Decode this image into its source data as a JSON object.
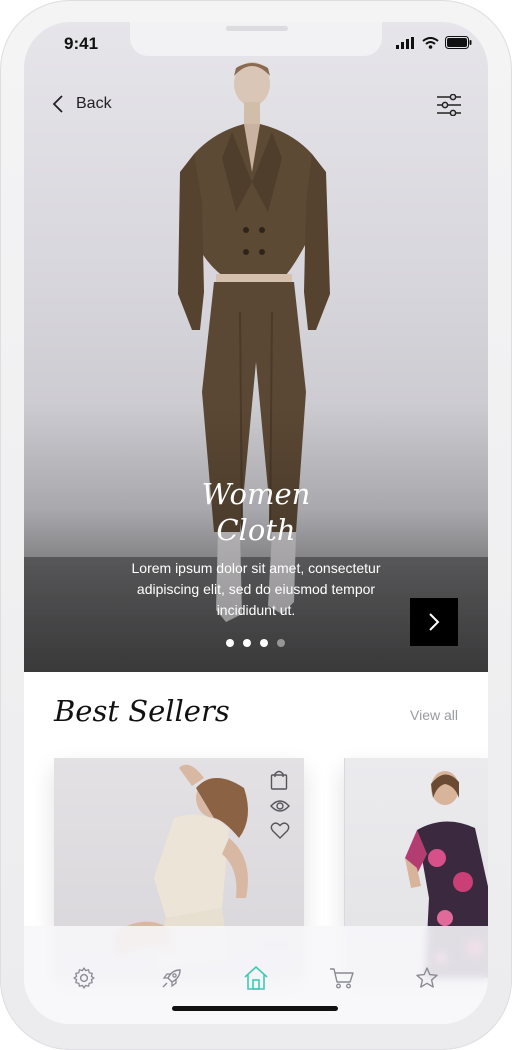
{
  "status_bar": {
    "time": "9:41"
  },
  "header": {
    "back_label": "Back",
    "filter_icon": "sliders-icon"
  },
  "hero": {
    "title_line1": "Women",
    "title_line2": "Cloth",
    "description": "Lorem ipsum dolor sit amet, consectetur adipiscing elit, sed do eiusmod tempor incididunt ut.",
    "carousel": {
      "total": 4,
      "visible_active": [
        1,
        2,
        3
      ]
    }
  },
  "best_sellers": {
    "title": "Best Sellers",
    "view_all_label": "View all",
    "cards": [
      {
        "actions": [
          "bag-icon",
          "eye-icon",
          "heart-icon"
        ],
        "more": "•••"
      },
      {
        "actions": []
      }
    ]
  },
  "bottom_nav": {
    "items": [
      "gear-icon",
      "rocket-icon",
      "home-icon",
      "cart-icon",
      "star-icon"
    ],
    "active_index": 2,
    "accent": "#3ec9b4"
  },
  "colors": {
    "hero_suit": "#5d4a35",
    "primary_text": "#111111",
    "muted_text": "#9a9aa4",
    "icon_gray": "#8a8a94"
  }
}
